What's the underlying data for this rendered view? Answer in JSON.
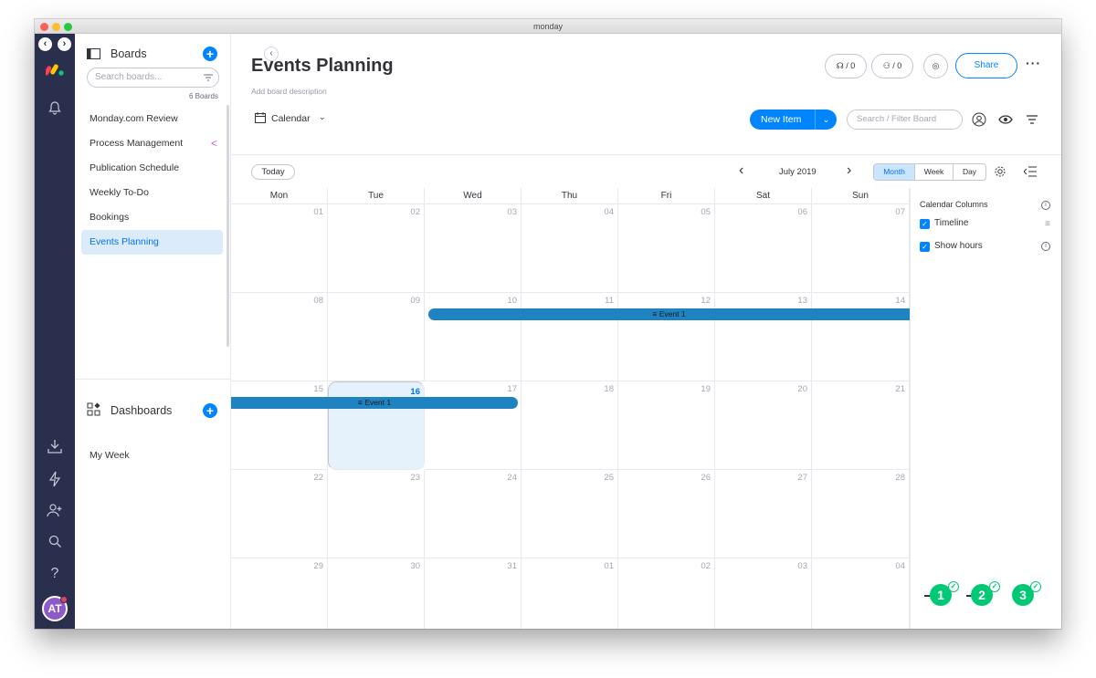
{
  "window": {
    "title": "monday"
  },
  "sidebar": {
    "boards_label": "Boards",
    "search_placeholder": "Search boards...",
    "board_count": "6 Boards",
    "items": [
      {
        "label": "Monday.com Review"
      },
      {
        "label": "Process Management",
        "shared": true
      },
      {
        "label": "Publication Schedule"
      },
      {
        "label": "Weekly To-Do"
      },
      {
        "label": "Bookings"
      },
      {
        "label": "Events Planning",
        "active": true
      }
    ],
    "dashboards_label": "Dashboards",
    "dashboards": [
      {
        "label": "My Week"
      }
    ]
  },
  "user": {
    "initials": "AT"
  },
  "header": {
    "title": "Events Planning",
    "description": "Add board description",
    "activity_count_1": "/ 0",
    "activity_count_2": "/ 0",
    "share_label": "Share"
  },
  "toolbar": {
    "view_label": "Calendar",
    "new_item_label": "New Item",
    "search_placeholder": "Search / Filter Board"
  },
  "calendar": {
    "today_label": "Today",
    "month_label": "July 2019",
    "views": [
      "Month",
      "Week",
      "Day"
    ],
    "active_view": "Month",
    "weekdays": [
      "Mon",
      "Tue",
      "Wed",
      "Thu",
      "Fri",
      "Sat",
      "Sun"
    ],
    "weeks": [
      [
        "01",
        "02",
        "03",
        "04",
        "05",
        "06",
        "07"
      ],
      [
        "08",
        "09",
        "10",
        "11",
        "12",
        "13",
        "14"
      ],
      [
        "15",
        "16",
        "17",
        "18",
        "19",
        "20",
        "21"
      ],
      [
        "22",
        "23",
        "24",
        "25",
        "26",
        "27",
        "28"
      ],
      [
        "29",
        "30",
        "31",
        "01",
        "02",
        "03",
        "04"
      ]
    ],
    "today": "16",
    "events": [
      {
        "label": "Event 1",
        "start": "2019-07-10",
        "end": "2019-07-14"
      },
      {
        "label": "Event 1",
        "start": "2019-07-15",
        "end": "2019-07-17"
      }
    ]
  },
  "calendar_columns": {
    "title": "Calendar Columns",
    "items": [
      {
        "label": "Timeline",
        "checked": true
      },
      {
        "label": "Show hours",
        "checked": true
      }
    ]
  },
  "steps": [
    "1",
    "2",
    "3"
  ],
  "colors": {
    "accent": "#0085ff",
    "rail": "#292f4c",
    "event": "#1f83c2",
    "success": "#00c875"
  }
}
